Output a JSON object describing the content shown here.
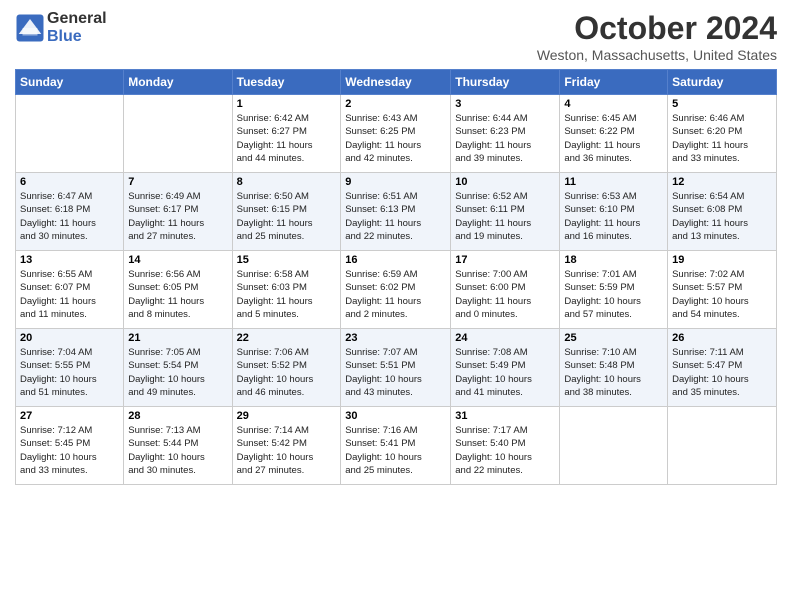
{
  "header": {
    "logo_text_general": "General",
    "logo_text_blue": "Blue",
    "month_title": "October 2024",
    "location": "Weston, Massachusetts, United States"
  },
  "calendar": {
    "days_of_week": [
      "Sunday",
      "Monday",
      "Tuesday",
      "Wednesday",
      "Thursday",
      "Friday",
      "Saturday"
    ],
    "rows": [
      [
        {
          "day": "",
          "details": ""
        },
        {
          "day": "",
          "details": ""
        },
        {
          "day": "1",
          "details": "Sunrise: 6:42 AM\nSunset: 6:27 PM\nDaylight: 11 hours\nand 44 minutes."
        },
        {
          "day": "2",
          "details": "Sunrise: 6:43 AM\nSunset: 6:25 PM\nDaylight: 11 hours\nand 42 minutes."
        },
        {
          "day": "3",
          "details": "Sunrise: 6:44 AM\nSunset: 6:23 PM\nDaylight: 11 hours\nand 39 minutes."
        },
        {
          "day": "4",
          "details": "Sunrise: 6:45 AM\nSunset: 6:22 PM\nDaylight: 11 hours\nand 36 minutes."
        },
        {
          "day": "5",
          "details": "Sunrise: 6:46 AM\nSunset: 6:20 PM\nDaylight: 11 hours\nand 33 minutes."
        }
      ],
      [
        {
          "day": "6",
          "details": "Sunrise: 6:47 AM\nSunset: 6:18 PM\nDaylight: 11 hours\nand 30 minutes."
        },
        {
          "day": "7",
          "details": "Sunrise: 6:49 AM\nSunset: 6:17 PM\nDaylight: 11 hours\nand 27 minutes."
        },
        {
          "day": "8",
          "details": "Sunrise: 6:50 AM\nSunset: 6:15 PM\nDaylight: 11 hours\nand 25 minutes."
        },
        {
          "day": "9",
          "details": "Sunrise: 6:51 AM\nSunset: 6:13 PM\nDaylight: 11 hours\nand 22 minutes."
        },
        {
          "day": "10",
          "details": "Sunrise: 6:52 AM\nSunset: 6:11 PM\nDaylight: 11 hours\nand 19 minutes."
        },
        {
          "day": "11",
          "details": "Sunrise: 6:53 AM\nSunset: 6:10 PM\nDaylight: 11 hours\nand 16 minutes."
        },
        {
          "day": "12",
          "details": "Sunrise: 6:54 AM\nSunset: 6:08 PM\nDaylight: 11 hours\nand 13 minutes."
        }
      ],
      [
        {
          "day": "13",
          "details": "Sunrise: 6:55 AM\nSunset: 6:07 PM\nDaylight: 11 hours\nand 11 minutes."
        },
        {
          "day": "14",
          "details": "Sunrise: 6:56 AM\nSunset: 6:05 PM\nDaylight: 11 hours\nand 8 minutes."
        },
        {
          "day": "15",
          "details": "Sunrise: 6:58 AM\nSunset: 6:03 PM\nDaylight: 11 hours\nand 5 minutes."
        },
        {
          "day": "16",
          "details": "Sunrise: 6:59 AM\nSunset: 6:02 PM\nDaylight: 11 hours\nand 2 minutes."
        },
        {
          "day": "17",
          "details": "Sunrise: 7:00 AM\nSunset: 6:00 PM\nDaylight: 11 hours\nand 0 minutes."
        },
        {
          "day": "18",
          "details": "Sunrise: 7:01 AM\nSunset: 5:59 PM\nDaylight: 10 hours\nand 57 minutes."
        },
        {
          "day": "19",
          "details": "Sunrise: 7:02 AM\nSunset: 5:57 PM\nDaylight: 10 hours\nand 54 minutes."
        }
      ],
      [
        {
          "day": "20",
          "details": "Sunrise: 7:04 AM\nSunset: 5:55 PM\nDaylight: 10 hours\nand 51 minutes."
        },
        {
          "day": "21",
          "details": "Sunrise: 7:05 AM\nSunset: 5:54 PM\nDaylight: 10 hours\nand 49 minutes."
        },
        {
          "day": "22",
          "details": "Sunrise: 7:06 AM\nSunset: 5:52 PM\nDaylight: 10 hours\nand 46 minutes."
        },
        {
          "day": "23",
          "details": "Sunrise: 7:07 AM\nSunset: 5:51 PM\nDaylight: 10 hours\nand 43 minutes."
        },
        {
          "day": "24",
          "details": "Sunrise: 7:08 AM\nSunset: 5:49 PM\nDaylight: 10 hours\nand 41 minutes."
        },
        {
          "day": "25",
          "details": "Sunrise: 7:10 AM\nSunset: 5:48 PM\nDaylight: 10 hours\nand 38 minutes."
        },
        {
          "day": "26",
          "details": "Sunrise: 7:11 AM\nSunset: 5:47 PM\nDaylight: 10 hours\nand 35 minutes."
        }
      ],
      [
        {
          "day": "27",
          "details": "Sunrise: 7:12 AM\nSunset: 5:45 PM\nDaylight: 10 hours\nand 33 minutes."
        },
        {
          "day": "28",
          "details": "Sunrise: 7:13 AM\nSunset: 5:44 PM\nDaylight: 10 hours\nand 30 minutes."
        },
        {
          "day": "29",
          "details": "Sunrise: 7:14 AM\nSunset: 5:42 PM\nDaylight: 10 hours\nand 27 minutes."
        },
        {
          "day": "30",
          "details": "Sunrise: 7:16 AM\nSunset: 5:41 PM\nDaylight: 10 hours\nand 25 minutes."
        },
        {
          "day": "31",
          "details": "Sunrise: 7:17 AM\nSunset: 5:40 PM\nDaylight: 10 hours\nand 22 minutes."
        },
        {
          "day": "",
          "details": ""
        },
        {
          "day": "",
          "details": ""
        }
      ]
    ]
  }
}
